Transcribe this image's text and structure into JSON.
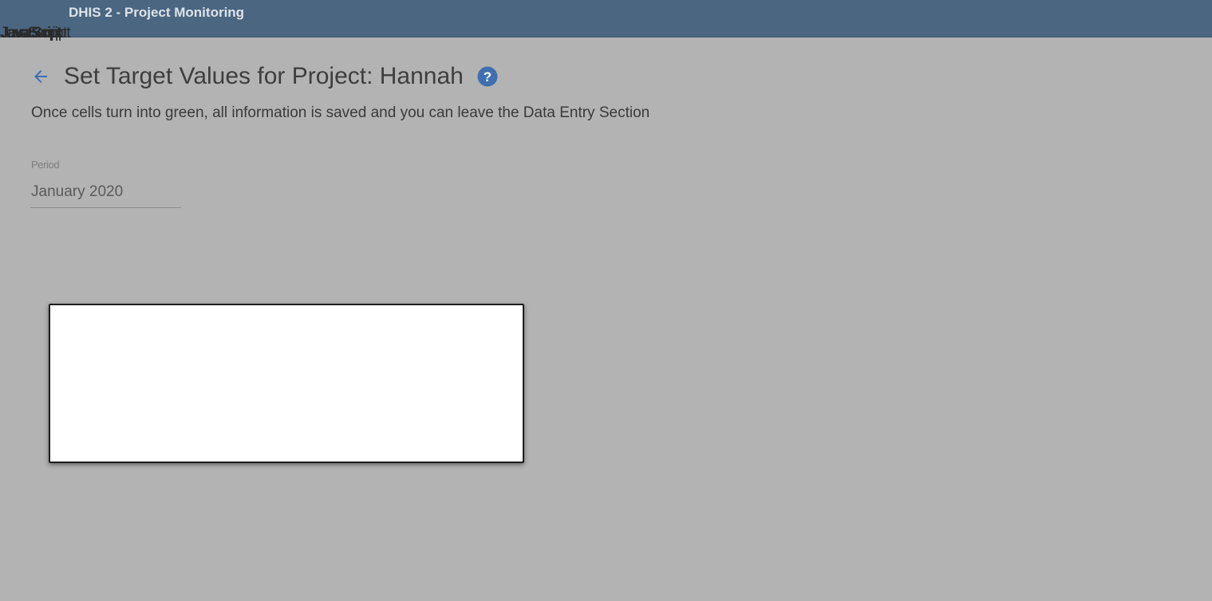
{
  "header": {
    "app_title": "DHIS 2 - Project Monitoring",
    "noscript_texts": [
      "JavaScript",
      "JavaScript",
      "JavaScript",
      "JavaScript",
      "JavaScript"
    ]
  },
  "page": {
    "title": "Set Target Values for Project: Hannah",
    "info": "Once cells turn into green, all information is saved and you can leave the Data Entry Section",
    "back_icon": "arrow-left-icon",
    "help_icon": "help-circle-icon"
  },
  "period": {
    "label": "Period",
    "value": "January 2020"
  },
  "colors": {
    "topbar": "#4a6680",
    "overlay_background": "#b3b3b3",
    "accent": "#3f6fb0",
    "dialog_background": "#ffffff"
  }
}
